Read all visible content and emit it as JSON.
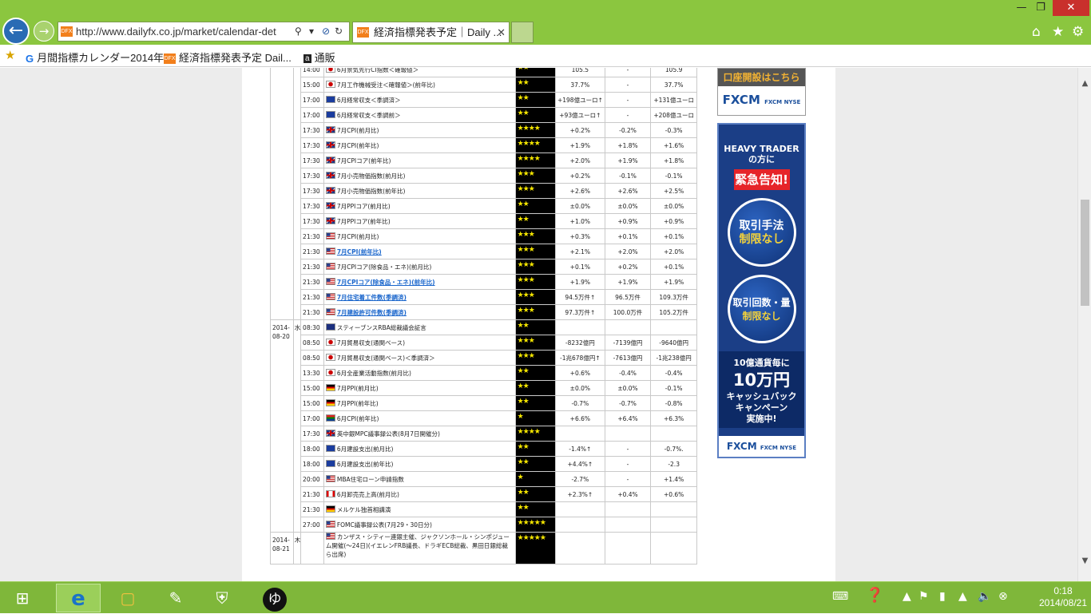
{
  "browser": {
    "url": "http://www.dailyfx.co.jp/market/calendar-det",
    "tab_title": "経済指標発表予定｜Daily ...",
    "favicon_text": "DFX",
    "favorites": [
      {
        "label": "月間指標カレンダー2014年...",
        "icon": "google-icon"
      },
      {
        "label": "経済指標発表予定  Dail...",
        "icon": "dfx-icon"
      },
      {
        "label": "通販",
        "icon": "amazon-icon"
      }
    ]
  },
  "rows": [
    {
      "date": "",
      "day": "",
      "time": "14:00",
      "flag": "jp",
      "event": "6月景気先行CI指数＜確報値＞",
      "link": false,
      "stars": "★★",
      "actual": "105.5",
      "forecast": "-",
      "previous": "105.9"
    },
    {
      "date": "",
      "day": "",
      "time": "15:00",
      "flag": "jp",
      "event": "7月工作機械受注＜確報値＞(前年比)",
      "link": false,
      "stars": "★★",
      "actual": "37.7%",
      "forecast": "-",
      "previous": "37.7%"
    },
    {
      "date": "",
      "day": "",
      "time": "17:00",
      "flag": "eu",
      "event": "6月経常収支＜季調済＞",
      "link": false,
      "stars": "★★",
      "actual": "+198億ユーロ↑",
      "forecast": "-",
      "previous": "+131億ユーロ"
    },
    {
      "date": "",
      "day": "",
      "time": "17:00",
      "flag": "eu",
      "event": "6月経常収支＜季調前＞",
      "link": false,
      "stars": "★★",
      "actual": "+93億ユーロ↑",
      "forecast": "-",
      "previous": "+208億ユーロ"
    },
    {
      "date": "",
      "day": "",
      "time": "17:30",
      "flag": "gb",
      "event": "7月CPI(前月比)",
      "link": false,
      "stars": "★★★★",
      "actual": "+0.2%",
      "forecast": "-0.2%",
      "previous": "-0.3%"
    },
    {
      "date": "",
      "day": "",
      "time": "17:30",
      "flag": "gb",
      "event": "7月CPI(前年比)",
      "link": false,
      "stars": "★★★★",
      "actual": "+1.9%",
      "forecast": "+1.8%",
      "previous": "+1.6%"
    },
    {
      "date": "",
      "day": "",
      "time": "17:30",
      "flag": "gb",
      "event": "7月CPIコア(前年比)",
      "link": false,
      "stars": "★★★★",
      "actual": "+2.0%",
      "forecast": "+1.9%",
      "previous": "+1.8%"
    },
    {
      "date": "",
      "day": "",
      "time": "17:30",
      "flag": "gb",
      "event": "7月小売物価指数(前月比)",
      "link": false,
      "stars": "★★★",
      "actual": "+0.2%",
      "forecast": "-0.1%",
      "previous": "-0.1%"
    },
    {
      "date": "",
      "day": "",
      "time": "17:30",
      "flag": "gb",
      "event": "7月小売物価指数(前年比)",
      "link": false,
      "stars": "★★★",
      "actual": "+2.6%",
      "forecast": "+2.6%",
      "previous": "+2.5%"
    },
    {
      "date": "",
      "day": "",
      "time": "17:30",
      "flag": "gb",
      "event": "7月PPIコア(前月比)",
      "link": false,
      "stars": "★★",
      "actual": "±0.0%",
      "forecast": "±0.0%",
      "previous": "±0.0%"
    },
    {
      "date": "",
      "day": "",
      "time": "17:30",
      "flag": "gb",
      "event": "7月PPIコア(前年比)",
      "link": false,
      "stars": "★★",
      "actual": "+1.0%",
      "forecast": "+0.9%",
      "previous": "+0.9%"
    },
    {
      "date": "",
      "day": "",
      "time": "21:30",
      "flag": "us",
      "event": "7月CPI(前月比)",
      "link": false,
      "stars": "★★★",
      "actual": "+0.3%",
      "forecast": "+0.1%",
      "previous": "+0.1%"
    },
    {
      "date": "",
      "day": "",
      "time": "21:30",
      "flag": "us",
      "event": "7月CPI(前年比)",
      "link": true,
      "stars": "★★★",
      "actual": "+2.1%",
      "forecast": "+2.0%",
      "previous": "+2.0%"
    },
    {
      "date": "",
      "day": "",
      "time": "21:30",
      "flag": "us",
      "event": "7月CPIコア(除食品・エネ)(前月比)",
      "link": false,
      "stars": "★★★",
      "actual": "+0.1%",
      "forecast": "+0.2%",
      "previous": "+0.1%"
    },
    {
      "date": "",
      "day": "",
      "time": "21:30",
      "flag": "us",
      "event": "7月CPIコア(除食品・エネ)(前年比)",
      "link": true,
      "stars": "★★★",
      "actual": "+1.9%",
      "forecast": "+1.9%",
      "previous": "+1.9%"
    },
    {
      "date": "",
      "day": "",
      "time": "21:30",
      "flag": "us",
      "event": "7月住宅着工件数(季調済)",
      "link": true,
      "stars": "★★★",
      "actual": "94.5万件↑",
      "forecast": "96.5万件",
      "previous": "109.3万件"
    },
    {
      "date": "",
      "day": "",
      "time": "21:30",
      "flag": "us",
      "event": "7月建設許可件数(季調済)",
      "link": true,
      "stars": "★★★",
      "actual": "97.3万件↑",
      "forecast": "100.0万件",
      "previous": "105.2万件"
    },
    {
      "date": "2014-08-20",
      "day": "水",
      "time": "08:30",
      "flag": "au",
      "event": "スティーブンスRBA総裁議会証言",
      "link": false,
      "stars": "★★",
      "actual": "",
      "forecast": "",
      "previous": ""
    },
    {
      "date": "",
      "day": "",
      "time": "08:50",
      "flag": "jp",
      "event": "7月貿易収支(通関ベース)",
      "link": false,
      "stars": "★★★",
      "actual": "-8232億円",
      "forecast": "-7139億円",
      "previous": "-9640億円"
    },
    {
      "date": "",
      "day": "",
      "time": "08:50",
      "flag": "jp",
      "event": "7月貿易収支(通関ベース)＜季調済＞",
      "link": false,
      "stars": "★★★",
      "actual": "-1兆678億円↑",
      "forecast": "-7613億円",
      "previous": "-1兆238億円"
    },
    {
      "date": "",
      "day": "",
      "time": "13:30",
      "flag": "jp",
      "event": "6月全産業活動指数(前月比)",
      "link": false,
      "stars": "★★",
      "actual": "+0.6%",
      "forecast": "-0.4%",
      "previous": "-0.4%"
    },
    {
      "date": "",
      "day": "",
      "time": "15:00",
      "flag": "de",
      "event": "7月PPI(前月比)",
      "link": false,
      "stars": "★★",
      "actual": "±0.0%",
      "forecast": "±0.0%",
      "previous": "-0.1%"
    },
    {
      "date": "",
      "day": "",
      "time": "15:00",
      "flag": "de",
      "event": "7月PPI(前年比)",
      "link": false,
      "stars": "★★",
      "actual": "-0.7%",
      "forecast": "-0.7%",
      "previous": "-0.8%"
    },
    {
      "date": "",
      "day": "",
      "time": "17:00",
      "flag": "za",
      "event": "6月CPI(前年比)",
      "link": false,
      "stars": "★",
      "actual": "+6.6%",
      "forecast": "+6.4%",
      "previous": "+6.3%"
    },
    {
      "date": "",
      "day": "",
      "time": "17:30",
      "flag": "gb",
      "event": "英中銀MPC議事録公表(8月7日開催分)",
      "link": false,
      "stars": "★★★★",
      "actual": "",
      "forecast": "",
      "previous": ""
    },
    {
      "date": "",
      "day": "",
      "time": "18:00",
      "flag": "eu",
      "event": "6月建設支出(前月比)",
      "link": false,
      "stars": "★★",
      "actual": "-1.4%↑",
      "forecast": "-",
      "previous": "-0.7%."
    },
    {
      "date": "",
      "day": "",
      "time": "18:00",
      "flag": "eu",
      "event": "6月建設支出(前年比)",
      "link": false,
      "stars": "★★",
      "actual": "+4.4%↑",
      "forecast": "-",
      "previous": "-2.3"
    },
    {
      "date": "",
      "day": "",
      "time": "20:00",
      "flag": "us",
      "event": "MBA住宅ローン申請指数",
      "link": false,
      "stars": "★",
      "actual": "-2.7%",
      "forecast": "-",
      "previous": "+1.4%"
    },
    {
      "date": "",
      "day": "",
      "time": "21:30",
      "flag": "ca",
      "event": "6月卸売売上高(前月比)",
      "link": false,
      "stars": "★★",
      "actual": "+2.3%↑",
      "forecast": "+0.4%",
      "previous": "+0.6%"
    },
    {
      "date": "",
      "day": "",
      "time": "21:30",
      "flag": "de",
      "event": "メルケル独首相講演",
      "link": false,
      "stars": "★★",
      "actual": "",
      "forecast": "",
      "previous": ""
    },
    {
      "date": "",
      "day": "",
      "time": "27:00",
      "flag": "us",
      "event": "FOMC議事録公表(7月29・30日分)",
      "link": false,
      "stars": "★★★★★",
      "actual": "",
      "forecast": "",
      "previous": ""
    },
    {
      "date": "2014-08-21",
      "day": "木",
      "time": "",
      "flag": "us",
      "event": "カンザス・シティー連銀主催、ジャクソンホール・シンポジューム開催(～24日)(イエレンFRB議長、ドラギECB総裁、黒田日銀総裁ら出席)",
      "link": false,
      "stars": "★★★★★",
      "actual": "",
      "forecast": "",
      "previous": ""
    }
  ],
  "ads": {
    "account_banner": "口座開設はこちら",
    "fxcm_logo": "FXCM",
    "fxcm_sub": "FXCM NYSE",
    "heavy_trader": "HEAVY TRADER",
    "heavy_trader_sub": "の方に",
    "urgent": "緊急告知!",
    "circle1_line1": "取引手法",
    "circle1_line2": "制限なし",
    "circle2_line1": "取引回数・量",
    "circle2_line2": "制限なし",
    "per10": "10億通貨毎に",
    "amount": "10万円",
    "cashback": "キャッシュバック",
    "campaign": "キャンペーン",
    "ongoing": "実施中!"
  },
  "taskbar": {
    "time": "0:18",
    "date": "2014/08/21",
    "apps": [
      "start-icon",
      "ie-icon",
      "explorer-icon",
      "paint-icon",
      "shield-app-icon",
      "yu-app-icon"
    ]
  }
}
